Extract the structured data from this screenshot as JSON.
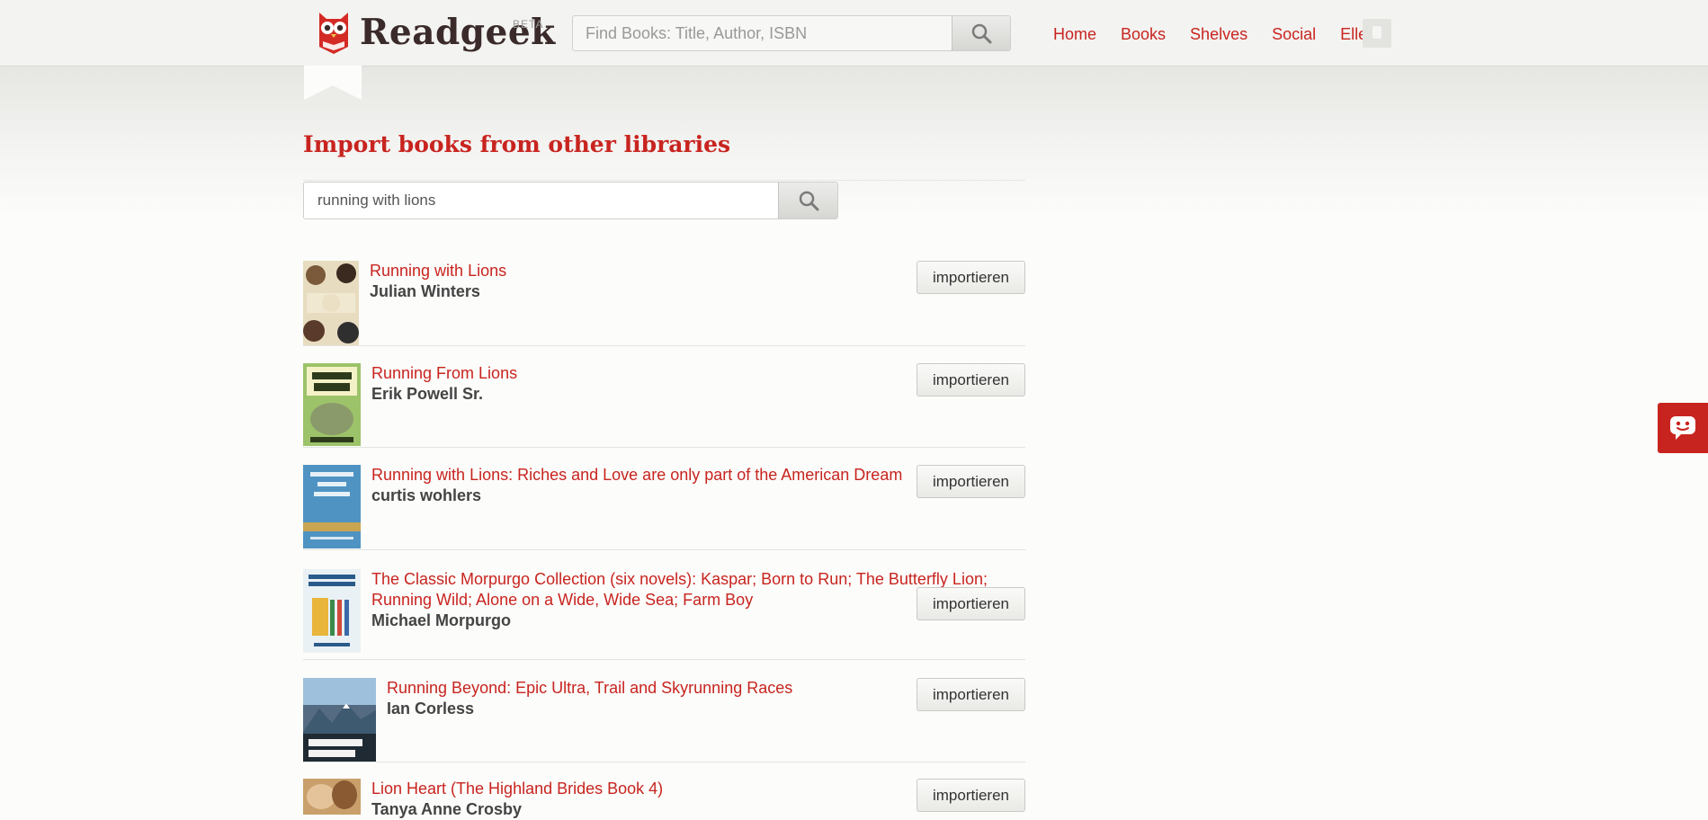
{
  "header": {
    "brand": "Readgeek",
    "beta": "BETA",
    "search_placeholder": "Find Books: Title, Author, ISBN",
    "nav": {
      "home": "Home",
      "books": "Books",
      "shelves": "Shelves",
      "social": "Social",
      "user": "Ellen"
    }
  },
  "main": {
    "title": "Import books from other libraries",
    "search_value": "running with lions"
  },
  "results": [
    {
      "title": "Running with Lions",
      "author": "Julian Winters",
      "button": "importieren"
    },
    {
      "title": "Running From Lions",
      "author": "Erik Powell Sr.",
      "button": "importieren"
    },
    {
      "title": "Running with Lions: Riches and Love are only part of the American Dream",
      "author": "curtis wohlers",
      "button": "importieren"
    },
    {
      "title": "The Classic Morpurgo Collection (six novels): Kaspar; Born to Run; The Butterfly Lion;",
      "title_line2": "Running Wild; Alone on a Wide, Wide Sea; Farm Boy",
      "author": "Michael Morpurgo",
      "button": "importieren"
    },
    {
      "title": "Running Beyond: Epic Ultra, Trail and Skyrunning Races",
      "author": "Ian Corless",
      "button": "importieren"
    },
    {
      "title": "Lion Heart (The Highland Brides Book 4)",
      "author": "Tanya Anne Crosby",
      "button": "importieren"
    }
  ],
  "covers": [
    {
      "text": "RUNNING WITH LIONS",
      "bg": "#e8dcc0"
    },
    {
      "text": "RUNNING FROM LIONS",
      "bg": "#9cc36a"
    },
    {
      "text": "Running with Lions",
      "bg": "#4f93c3"
    },
    {
      "text": "michael morpurgo",
      "bg": "#e9f1f5"
    },
    {
      "text": "RUNNING BEYOND",
      "bg": "#556b82"
    },
    {
      "text": "",
      "bg": "#c9a06b"
    }
  ],
  "colors": {
    "accent": "#c8241f",
    "author": "#444444",
    "background": "#fcfcfa"
  },
  "icons": {
    "logo": "owl-book-logo",
    "search": "search-icon",
    "feedback": "chat-face-icon"
  }
}
